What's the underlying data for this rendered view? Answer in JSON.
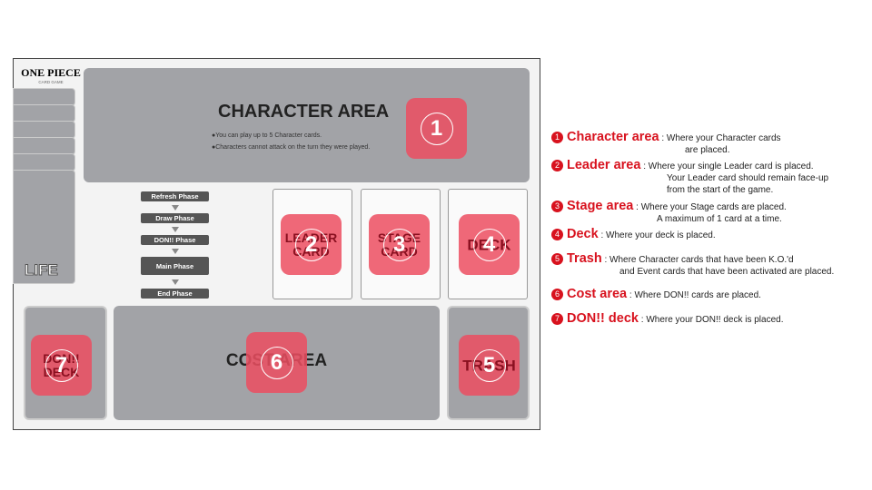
{
  "logo": {
    "title": "ONE PIECE",
    "subtitle": "CARD GAME"
  },
  "character_area": {
    "title": "CHARACTER AREA",
    "bullets": [
      "●You can play up to 5 Character cards.",
      "●Characters cannot attack on the turn they were played."
    ]
  },
  "life_label": "LIFE",
  "phases": [
    "Refresh Phase",
    "Draw Phase",
    "DON!! Phase",
    "Main Phase",
    "End Phase"
  ],
  "zones": {
    "leader": "LEADER CARD",
    "stage": "STAGE CARD",
    "deck": "DECK",
    "don_deck": "DON!! DECK",
    "cost": "COST AREA",
    "trash": "TRASH"
  },
  "badges": [
    "1",
    "2",
    "3",
    "4",
    "5",
    "6",
    "7"
  ],
  "legend": [
    {
      "num": "1",
      "name": "Character area",
      "desc": [
        "Where your Character cards",
        "are placed."
      ]
    },
    {
      "num": "2",
      "name": "Leader area",
      "desc": [
        "Where your single Leader card is placed.",
        "Your Leader card should remain face-up",
        "from the start of the game."
      ]
    },
    {
      "num": "3",
      "name": "Stage area",
      "desc": [
        "Where your Stage cards are placed.",
        "A maximum of 1 card at a time."
      ]
    },
    {
      "num": "4",
      "name": "Deck",
      "desc": [
        "Where your deck is placed."
      ]
    },
    {
      "num": "5",
      "name": "Trash",
      "desc": [
        "Where Character cards that have been K.O.'d",
        "and Event cards that have been activated are placed."
      ]
    },
    {
      "num": "6",
      "name": "Cost area",
      "desc": [
        "Where DON!! cards are placed."
      ]
    },
    {
      "num": "7",
      "name": "DON!! deck",
      "desc": [
        "Where your DON!! deck is placed."
      ]
    }
  ],
  "colors": {
    "accent": "#d8121e",
    "badge": "#ec4e60",
    "zone": "#a2a3a7"
  }
}
